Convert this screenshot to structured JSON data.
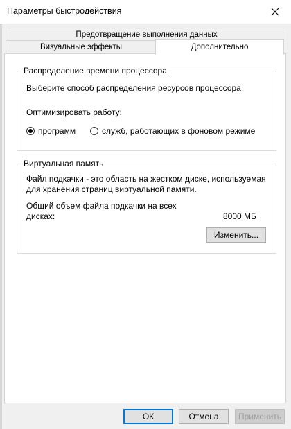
{
  "window": {
    "title": "Параметры быстродействия"
  },
  "tabs": {
    "row1": [
      "Предотвращение выполнения данных"
    ],
    "row2": [
      "Визуальные эффекты",
      "Дополнительно"
    ],
    "active": "Дополнительно"
  },
  "processor": {
    "title": "Распределение времени процессора",
    "description": "Выберите способ распределения ресурсов процессора.",
    "optimize_label": "Оптимизировать работу:",
    "options": [
      {
        "label": "программ",
        "selected": true
      },
      {
        "label": "служб, работающих в фоновом режиме",
        "selected": false
      }
    ]
  },
  "virtual_memory": {
    "title": "Виртуальная память",
    "description_line1": "Файл подкачки - это область на жестком диске, используемая",
    "description_line2": "для хранения страниц виртуальной памяти.",
    "total_label_line1": "Общий объем файла подкачки на всех",
    "total_label_line2": "дисках:",
    "total_value": "8000 МБ",
    "change_button": "Изменить..."
  },
  "footer": {
    "ok": "ОК",
    "cancel": "Отмена",
    "apply": "Применить"
  },
  "colors": {
    "focus_border": "#0078d7",
    "disabled_text": "#9e9e9e"
  }
}
